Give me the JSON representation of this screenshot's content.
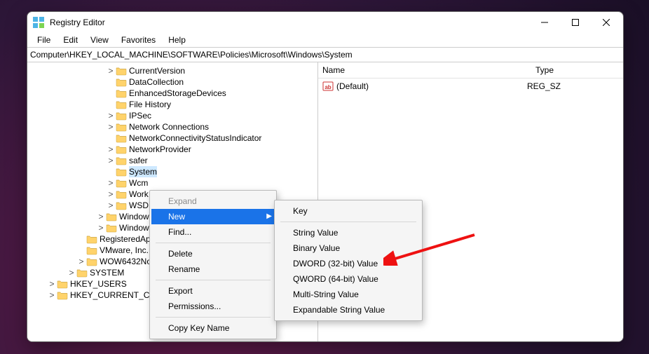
{
  "titlebar": {
    "title": "Registry Editor"
  },
  "menubar": {
    "file": "File",
    "edit": "Edit",
    "view": "View",
    "favorites": "Favorites",
    "help": "Help"
  },
  "addressbar": {
    "path": "Computer\\HKEY_LOCAL_MACHINE\\SOFTWARE\\Policies\\Microsoft\\Windows\\System"
  },
  "tree": {
    "items": [
      "CurrentVersion",
      "DataCollection",
      "EnhancedStorageDevices",
      "File History",
      "IPSec",
      "Network Connections",
      "NetworkConnectivityStatusIndicator",
      "NetworkProvider",
      "safer",
      "System",
      "Wcm",
      "Work",
      "WSD"
    ],
    "after": [
      "Window",
      "Window"
    ],
    "siblings": [
      "RegisteredApp",
      "VMware, Inc.",
      "WOW6432Noc"
    ],
    "back1": "SYSTEM",
    "back2": [
      "HKEY_USERS",
      "HKEY_CURRENT_CO"
    ]
  },
  "list": {
    "columns": {
      "name": "Name",
      "type": "Type"
    },
    "rows": [
      {
        "name": "(Default)",
        "type": "REG_SZ"
      }
    ]
  },
  "context_menu": {
    "expand": "Expand",
    "new": "New",
    "find": "Find...",
    "delete": "Delete",
    "rename": "Rename",
    "export": "Export",
    "permissions": "Permissions...",
    "copy_key": "Copy Key Name"
  },
  "submenu": {
    "key": "Key",
    "string": "String Value",
    "binary": "Binary Value",
    "dword": "DWORD (32-bit) Value",
    "qword": "QWORD (64-bit) Value",
    "multi": "Multi-String Value",
    "expand": "Expandable String Value"
  }
}
